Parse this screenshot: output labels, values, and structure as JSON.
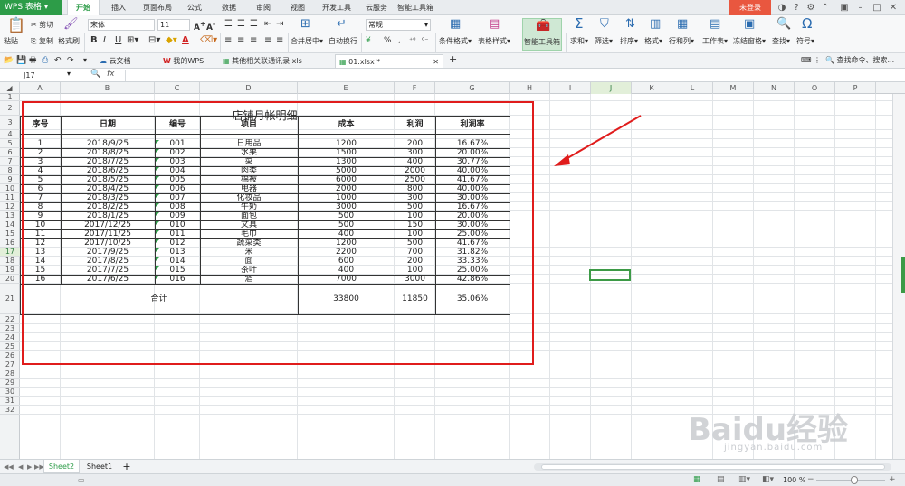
{
  "app": {
    "logo": "WPS 表格"
  },
  "menu": {
    "tabs": [
      "开始",
      "插入",
      "页面布局",
      "公式",
      "数据",
      "审阅",
      "视图",
      "开发工具",
      "云服务",
      "智能工具箱"
    ],
    "active_index": 0,
    "login_label": "未登录"
  },
  "ribbon": {
    "paste": "粘贴",
    "cut": "剪切",
    "copy": "复制",
    "format_painter": "格式刷",
    "font_name": "宋体",
    "font_size": "11",
    "bold": "B",
    "italic": "I",
    "underline": "U",
    "font_color_letter": "A",
    "merge_center": "合并居中",
    "wrap_text": "自动换行",
    "number_format": "常规",
    "currency_symbol": "¥",
    "percent_symbol": "%",
    "comma_style": ",",
    "cond_format": "条件格式",
    "table_style": "表格样式",
    "smart_toolbox": "智能工具箱",
    "sum": "求和",
    "filter": "筛选",
    "sort": "排序",
    "format": "格式",
    "row_col": "行和列",
    "worksheet": "工作表",
    "freeze": "冻结窗格",
    "find": "查找",
    "symbol": "符号"
  },
  "tabbar": {
    "tabs": [
      "云文档",
      "我的WPS",
      "其他相关联通讯录.xls",
      "01.xlsx *"
    ],
    "active_index": 3,
    "search_placeholder": "查找命令、搜索..."
  },
  "formula": {
    "cell_ref": "J17",
    "fx": "fx",
    "content": ""
  },
  "columns": [
    "A",
    "B",
    "C",
    "D",
    "E",
    "F",
    "G",
    "H",
    "I",
    "J",
    "K",
    "L",
    "M",
    "N",
    "O",
    "P"
  ],
  "selected_column": "J",
  "rows": [
    "1",
    "2",
    "3",
    "4",
    "5",
    "6",
    "7",
    "8",
    "9",
    "10",
    "11",
    "12",
    "13",
    "14",
    "15",
    "16",
    "17",
    "18",
    "19",
    "20",
    "21",
    "22",
    "23",
    "24",
    "25",
    "26",
    "27",
    "28",
    "29",
    "30",
    "31",
    "32"
  ],
  "selected_row": "17",
  "sheet": {
    "title": "店铺月帐明细",
    "headers": [
      "序号",
      "日期",
      "编号",
      "项目",
      "成本",
      "利润",
      "利润率"
    ],
    "records": [
      [
        "1",
        "2018/9/25",
        "001",
        "日用品",
        "1200",
        "200",
        "16.67%"
      ],
      [
        "2",
        "2018/8/25",
        "002",
        "水果",
        "1500",
        "300",
        "20.00%"
      ],
      [
        "3",
        "2018/7/25",
        "003",
        "菜",
        "1300",
        "400",
        "30.77%"
      ],
      [
        "4",
        "2018/6/25",
        "004",
        "肉类",
        "5000",
        "2000",
        "40.00%"
      ],
      [
        "5",
        "2018/5/25",
        "005",
        "棉被",
        "6000",
        "2500",
        "41.67%"
      ],
      [
        "6",
        "2018/4/25",
        "006",
        "电器",
        "2000",
        "800",
        "40.00%"
      ],
      [
        "7",
        "2018/3/25",
        "007",
        "化妆品",
        "1000",
        "300",
        "30.00%"
      ],
      [
        "8",
        "2018/2/25",
        "008",
        "牛奶",
        "3000",
        "500",
        "16.67%"
      ],
      [
        "9",
        "2018/1/25",
        "009",
        "面包",
        "500",
        "100",
        "20.00%"
      ],
      [
        "10",
        "2017/12/25",
        "010",
        "文具",
        "500",
        "150",
        "30.00%"
      ],
      [
        "11",
        "2017/11/25",
        "011",
        "毛巾",
        "400",
        "100",
        "25.00%"
      ],
      [
        "12",
        "2017/10/25",
        "012",
        "蔬菜类",
        "1200",
        "500",
        "41.67%"
      ],
      [
        "13",
        "2017/9/25",
        "013",
        "米",
        "2200",
        "700",
        "31.82%"
      ],
      [
        "14",
        "2017/8/25",
        "014",
        "面",
        "600",
        "200",
        "33.33%"
      ],
      [
        "15",
        "2017/7/25",
        "015",
        "茶叶",
        "400",
        "100",
        "25.00%"
      ],
      [
        "16",
        "2017/6/25",
        "016",
        "酒",
        "7000",
        "3000",
        "42.86%"
      ]
    ],
    "total_label": "合计",
    "total_cost": "33800",
    "total_profit": "11850",
    "total_rate": "35.06%"
  },
  "sheets": {
    "tabs": [
      "Sheet2",
      "Sheet1"
    ],
    "active_index": 0,
    "add": "+"
  },
  "status": {
    "zoom": "100 %"
  },
  "watermark": {
    "brand": "Baidu经验",
    "url": "jingyan.baidu.com"
  },
  "colors": {
    "accent": "#2d9c48",
    "highlight_box": "#e01c1c",
    "arrow": "#e01c1c"
  }
}
